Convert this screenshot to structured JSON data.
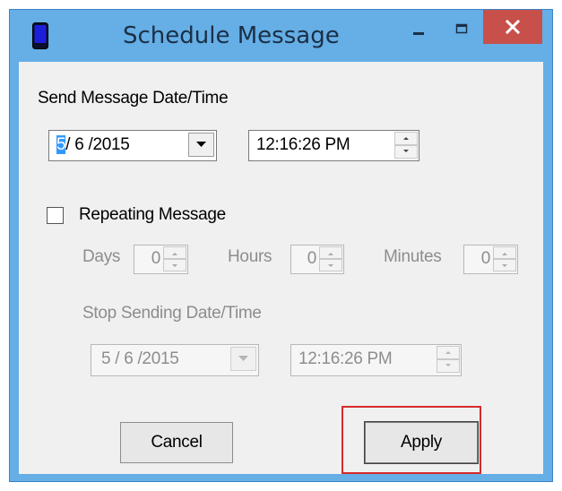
{
  "window": {
    "title": "Schedule Message",
    "app_icon": "phone-icon",
    "controls": [
      "minimize-icon",
      "maximize-icon",
      "close-icon"
    ]
  },
  "send": {
    "label": "Send Message Date/Time",
    "date_selected_part": "5",
    "date_rest": "/ 6 /2015",
    "time": "12:16:26 PM"
  },
  "repeat": {
    "checkbox_label": "Repeating Message",
    "checked": false,
    "days_label": "Days",
    "days_value": "0",
    "hours_label": "Hours",
    "hours_value": "0",
    "minutes_label": "Minutes",
    "minutes_value": "0"
  },
  "stop": {
    "label": "Stop Sending Date/Time",
    "date": "5 / 6 /2015",
    "time": "12:16:26 PM"
  },
  "buttons": {
    "cancel": "Cancel",
    "apply": "Apply"
  },
  "colors": {
    "frame": "#65aee6",
    "close_button": "#c7504b",
    "highlight_box": "#d52b2b",
    "selection": "#3399ff"
  }
}
